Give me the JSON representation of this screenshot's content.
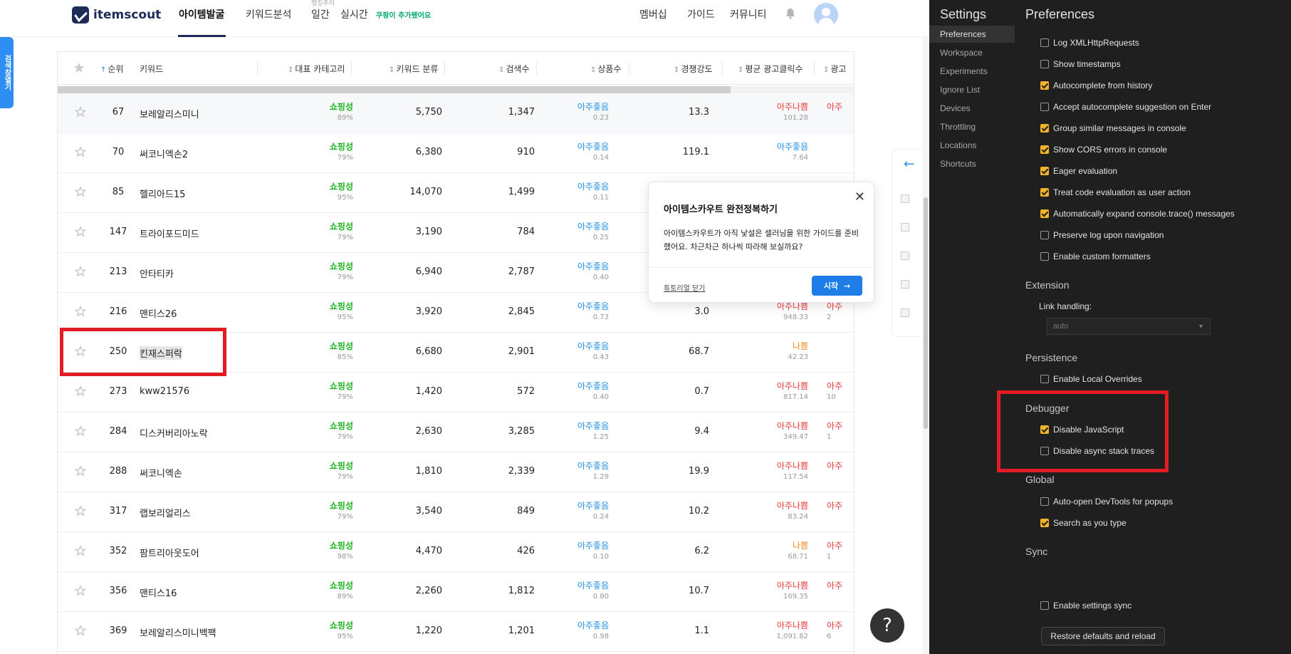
{
  "app": {
    "logo_text": "itemscout",
    "nav": [
      {
        "label": "아이템발굴",
        "active": true
      },
      {
        "label": "키워드분석",
        "active": false
      },
      {
        "label": "일간",
        "active": false
      },
      {
        "label": "실시간",
        "active": false
      }
    ],
    "nav_sup": "랭킹추이",
    "nav_badge": "쿠팡이 추가됐어요",
    "nav_right": [
      "멤버십",
      "가이드",
      "커뮤니티"
    ],
    "side_tab": "검색창열기",
    "table": {
      "headers": [
        "순위",
        "키워드",
        "대표 카테고리",
        "키워드 분류",
        "검색수",
        "상품수",
        "경쟁강도",
        "평균 광고클릭수",
        "광고"
      ],
      "rows": [
        {
          "rank": "67",
          "keyword": "보레알리스미니",
          "cat": "쇼핑성",
          "cat_pct": "89%",
          "products": "5,750",
          "search": "1,347",
          "comp": "아주좋음",
          "comp_val": "0.23",
          "intensity": "13.3",
          "ad": "아주나쁨",
          "ad_val": "101.28",
          "ad_color": "red",
          "extra": "아주",
          "extra_val": ""
        },
        {
          "rank": "70",
          "keyword": "써코니엑손2",
          "cat": "쇼핑성",
          "cat_pct": "79%",
          "products": "6,380",
          "search": "910",
          "comp": "아주좋음",
          "comp_val": "0.14",
          "intensity": "119.1",
          "ad": "아주좋음",
          "ad_val": "7.64",
          "ad_color": "blue",
          "extra": "",
          "extra_val": ""
        },
        {
          "rank": "85",
          "keyword": "헬리아드15",
          "cat": "쇼핑성",
          "cat_pct": "95%",
          "products": "14,070",
          "search": "1,499",
          "comp": "아주좋음",
          "comp_val": "0.11",
          "intensity": "",
          "ad": "",
          "ad_val": "",
          "ad_color": "red",
          "extra": "",
          "extra_val": ""
        },
        {
          "rank": "147",
          "keyword": "트라이포드미드",
          "cat": "쇼핑성",
          "cat_pct": "79%",
          "products": "3,190",
          "search": "784",
          "comp": "아주좋음",
          "comp_val": "0.25",
          "intensity": "",
          "ad": "",
          "ad_val": "",
          "ad_color": "red",
          "extra": "",
          "extra_val": ""
        },
        {
          "rank": "213",
          "keyword": "안타티카",
          "cat": "쇼핑성",
          "cat_pct": "79%",
          "products": "6,940",
          "search": "2,787",
          "comp": "아주좋음",
          "comp_val": "0.40",
          "intensity": "",
          "ad": "",
          "ad_val": "",
          "ad_color": "red",
          "extra": "",
          "extra_val": ""
        },
        {
          "rank": "216",
          "keyword": "맨티스26",
          "cat": "쇼핑성",
          "cat_pct": "95%",
          "products": "3,920",
          "search": "2,845",
          "comp": "아주좋음",
          "comp_val": "0.73",
          "intensity": "3.0",
          "ad": "아주나쁨",
          "ad_val": "948.33",
          "ad_color": "red",
          "extra": "아주",
          "extra_val": "2"
        },
        {
          "rank": "250",
          "keyword": "킨재스퍼락",
          "cat": "쇼핑성",
          "cat_pct": "85%",
          "products": "6,680",
          "search": "2,901",
          "comp": "아주좋음",
          "comp_val": "0.43",
          "intensity": "68.7",
          "ad": "나쁨",
          "ad_val": "42.23",
          "ad_color": "orange",
          "extra": "",
          "extra_val": ""
        },
        {
          "rank": "273",
          "keyword": "kww21576",
          "cat": "쇼핑성",
          "cat_pct": "79%",
          "products": "1,420",
          "search": "572",
          "comp": "아주좋음",
          "comp_val": "0.40",
          "intensity": "0.7",
          "ad": "아주나쁨",
          "ad_val": "817.14",
          "ad_color": "red",
          "extra": "아주",
          "extra_val": "10"
        },
        {
          "rank": "284",
          "keyword": "디스커버리아노락",
          "cat": "쇼핑성",
          "cat_pct": "79%",
          "products": "2,630",
          "search": "3,285",
          "comp": "아주좋음",
          "comp_val": "1.25",
          "intensity": "9.4",
          "ad": "아주나쁨",
          "ad_val": "349.47",
          "ad_color": "red",
          "extra": "아주",
          "extra_val": "1"
        },
        {
          "rank": "288",
          "keyword": "써코니엑손",
          "cat": "쇼핑성",
          "cat_pct": "79%",
          "products": "1,810",
          "search": "2,339",
          "comp": "아주좋음",
          "comp_val": "1.29",
          "intensity": "19.9",
          "ad": "아주나쁨",
          "ad_val": "117.54",
          "ad_color": "red",
          "extra": "아주",
          "extra_val": ""
        },
        {
          "rank": "317",
          "keyword": "랩보리얼리스",
          "cat": "쇼핑성",
          "cat_pct": "79%",
          "products": "3,540",
          "search": "849",
          "comp": "아주좋음",
          "comp_val": "0.24",
          "intensity": "10.2",
          "ad": "아주나쁨",
          "ad_val": "83.24",
          "ad_color": "red",
          "extra": "아주",
          "extra_val": ""
        },
        {
          "rank": "352",
          "keyword": "팜트리아웃도어",
          "cat": "쇼핑성",
          "cat_pct": "98%",
          "products": "4,470",
          "search": "426",
          "comp": "아주좋음",
          "comp_val": "0.10",
          "intensity": "6.2",
          "ad": "나쁨",
          "ad_val": "68.71",
          "ad_color": "orange",
          "extra": "아주",
          "extra_val": "1"
        },
        {
          "rank": "356",
          "keyword": "맨티스16",
          "cat": "쇼핑성",
          "cat_pct": "89%",
          "products": "2,260",
          "search": "1,812",
          "comp": "아주좋음",
          "comp_val": "0.80",
          "intensity": "10.7",
          "ad": "아주나쁨",
          "ad_val": "169.35",
          "ad_color": "red",
          "extra": "아주",
          "extra_val": ""
        },
        {
          "rank": "369",
          "keyword": "보레알리스미니백팩",
          "cat": "쇼핑성",
          "cat_pct": "95%",
          "products": "1,220",
          "search": "1,201",
          "comp": "아주좋음",
          "comp_val": "0.98",
          "intensity": "1.1",
          "ad": "아주나쁨",
          "ad_val": "1,091.82",
          "ad_color": "red",
          "extra": "아주",
          "extra_val": "6"
        }
      ]
    },
    "popover": {
      "title": "아이템스카우트 완전정복하기",
      "body": "아이템스카우트가 아직 낯설은 셀러님을 위한 가이드를 준비했어요. 차근차근 하나씩 따라해 보실까요?",
      "dismiss": "튜토리얼 닫기",
      "start": "시작",
      "close": "✕"
    },
    "help": "?"
  },
  "devtools": {
    "title": "Settings",
    "sidebar": [
      "Preferences",
      "Workspace",
      "Experiments",
      "Ignore List",
      "Devices",
      "Throttling",
      "Locations",
      "Shortcuts"
    ],
    "active": "Preferences",
    "heading": "Preferences",
    "console_options": [
      {
        "label": "Log XMLHttpRequests",
        "checked": false
      },
      {
        "label": "Show timestamps",
        "checked": false
      },
      {
        "label": "Autocomplete from history",
        "checked": true
      },
      {
        "label": "Accept autocomplete suggestion on Enter",
        "checked": false
      },
      {
        "label": "Group similar messages in console",
        "checked": true
      },
      {
        "label": "Show CORS errors in console",
        "checked": true
      },
      {
        "label": "Eager evaluation",
        "checked": true
      },
      {
        "label": "Treat code evaluation as user action",
        "checked": true
      },
      {
        "label": "Automatically expand console.trace() messages",
        "checked": true
      },
      {
        "label": "Preserve log upon navigation",
        "checked": false
      },
      {
        "label": "Enable custom formatters",
        "checked": false
      }
    ],
    "extension": {
      "title": "Extension",
      "link_label": "Link handling:",
      "select_value": "auto"
    },
    "persistence": {
      "title": "Persistence",
      "options": [
        {
          "label": "Enable Local Overrides",
          "checked": false
        }
      ]
    },
    "debugger": {
      "title": "Debugger",
      "options": [
        {
          "label": "Disable JavaScript",
          "checked": true
        },
        {
          "label": "Disable async stack traces",
          "checked": false
        }
      ]
    },
    "global": {
      "title": "Global",
      "options": [
        {
          "label": "Auto-open DevTools for popups",
          "checked": false
        },
        {
          "label": "Search as you type",
          "checked": true
        }
      ]
    },
    "sync": {
      "title": "Sync",
      "options": [
        {
          "label": "Enable settings sync",
          "checked": false
        }
      ]
    },
    "restore_button": "Restore defaults and reload"
  }
}
